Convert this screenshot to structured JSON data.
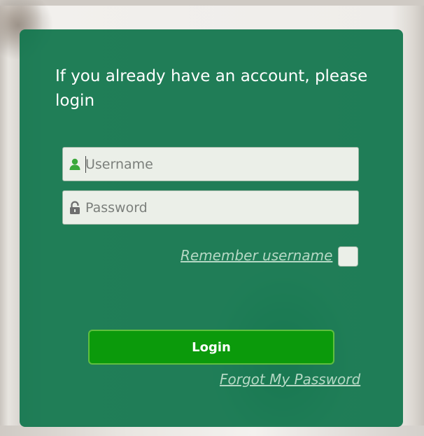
{
  "login_panel": {
    "heading": "If you already have an account, please login",
    "username": {
      "placeholder": "Username",
      "value": "",
      "icon": "user-icon"
    },
    "password": {
      "placeholder": "Password",
      "value": "",
      "icon": "lock-icon"
    },
    "remember": {
      "label": "Remember username",
      "checked": false
    },
    "login_button_label": "Login",
    "forgot_password_label": "Forgot My Password"
  },
  "colors": {
    "panel": "#12764e",
    "button": "#0b9a0b",
    "button_border": "#5fbf3f",
    "link": "#b5d8c4",
    "input_bg": "#ebefe8",
    "user_icon": "#3aa83a",
    "lock_icon": "#6e6e6e"
  }
}
